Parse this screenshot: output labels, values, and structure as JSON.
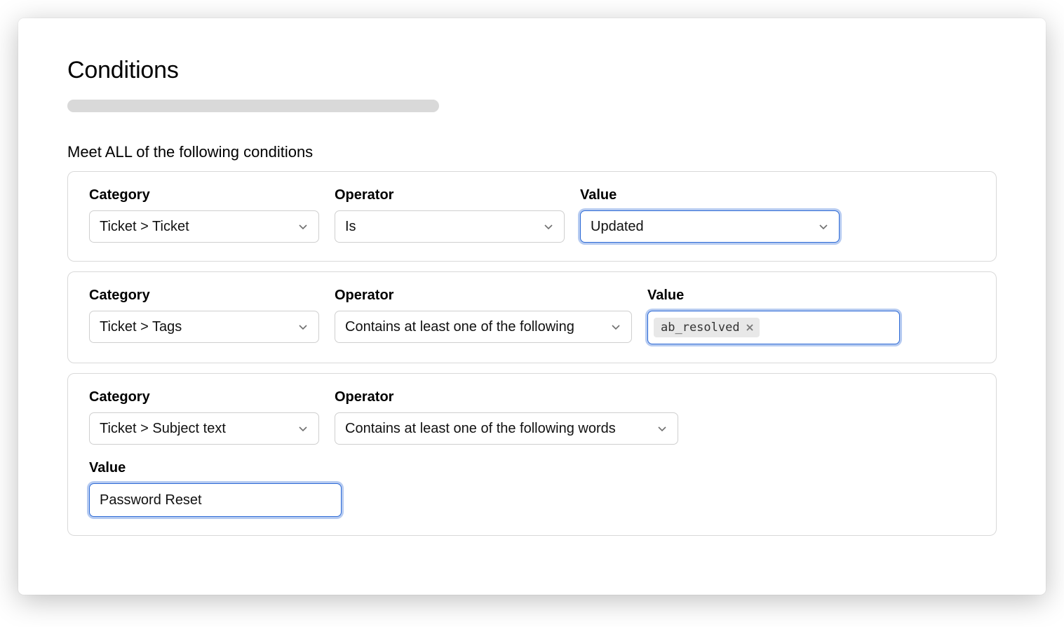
{
  "title": "Conditions",
  "section_label": "Meet ALL of the following conditions",
  "labels": {
    "category": "Category",
    "operator": "Operator",
    "value": "Value"
  },
  "conditions": [
    {
      "category": "Ticket > Ticket",
      "operator": "Is",
      "value_type": "select",
      "value": "Updated"
    },
    {
      "category": "Ticket > Tags",
      "operator": "Contains at least one of the following",
      "value_type": "tags",
      "tags": [
        "ab_resolved"
      ]
    },
    {
      "category": "Ticket > Subject text",
      "operator": "Contains at least one of the following words",
      "value_type": "text",
      "value": "Password Reset"
    }
  ]
}
